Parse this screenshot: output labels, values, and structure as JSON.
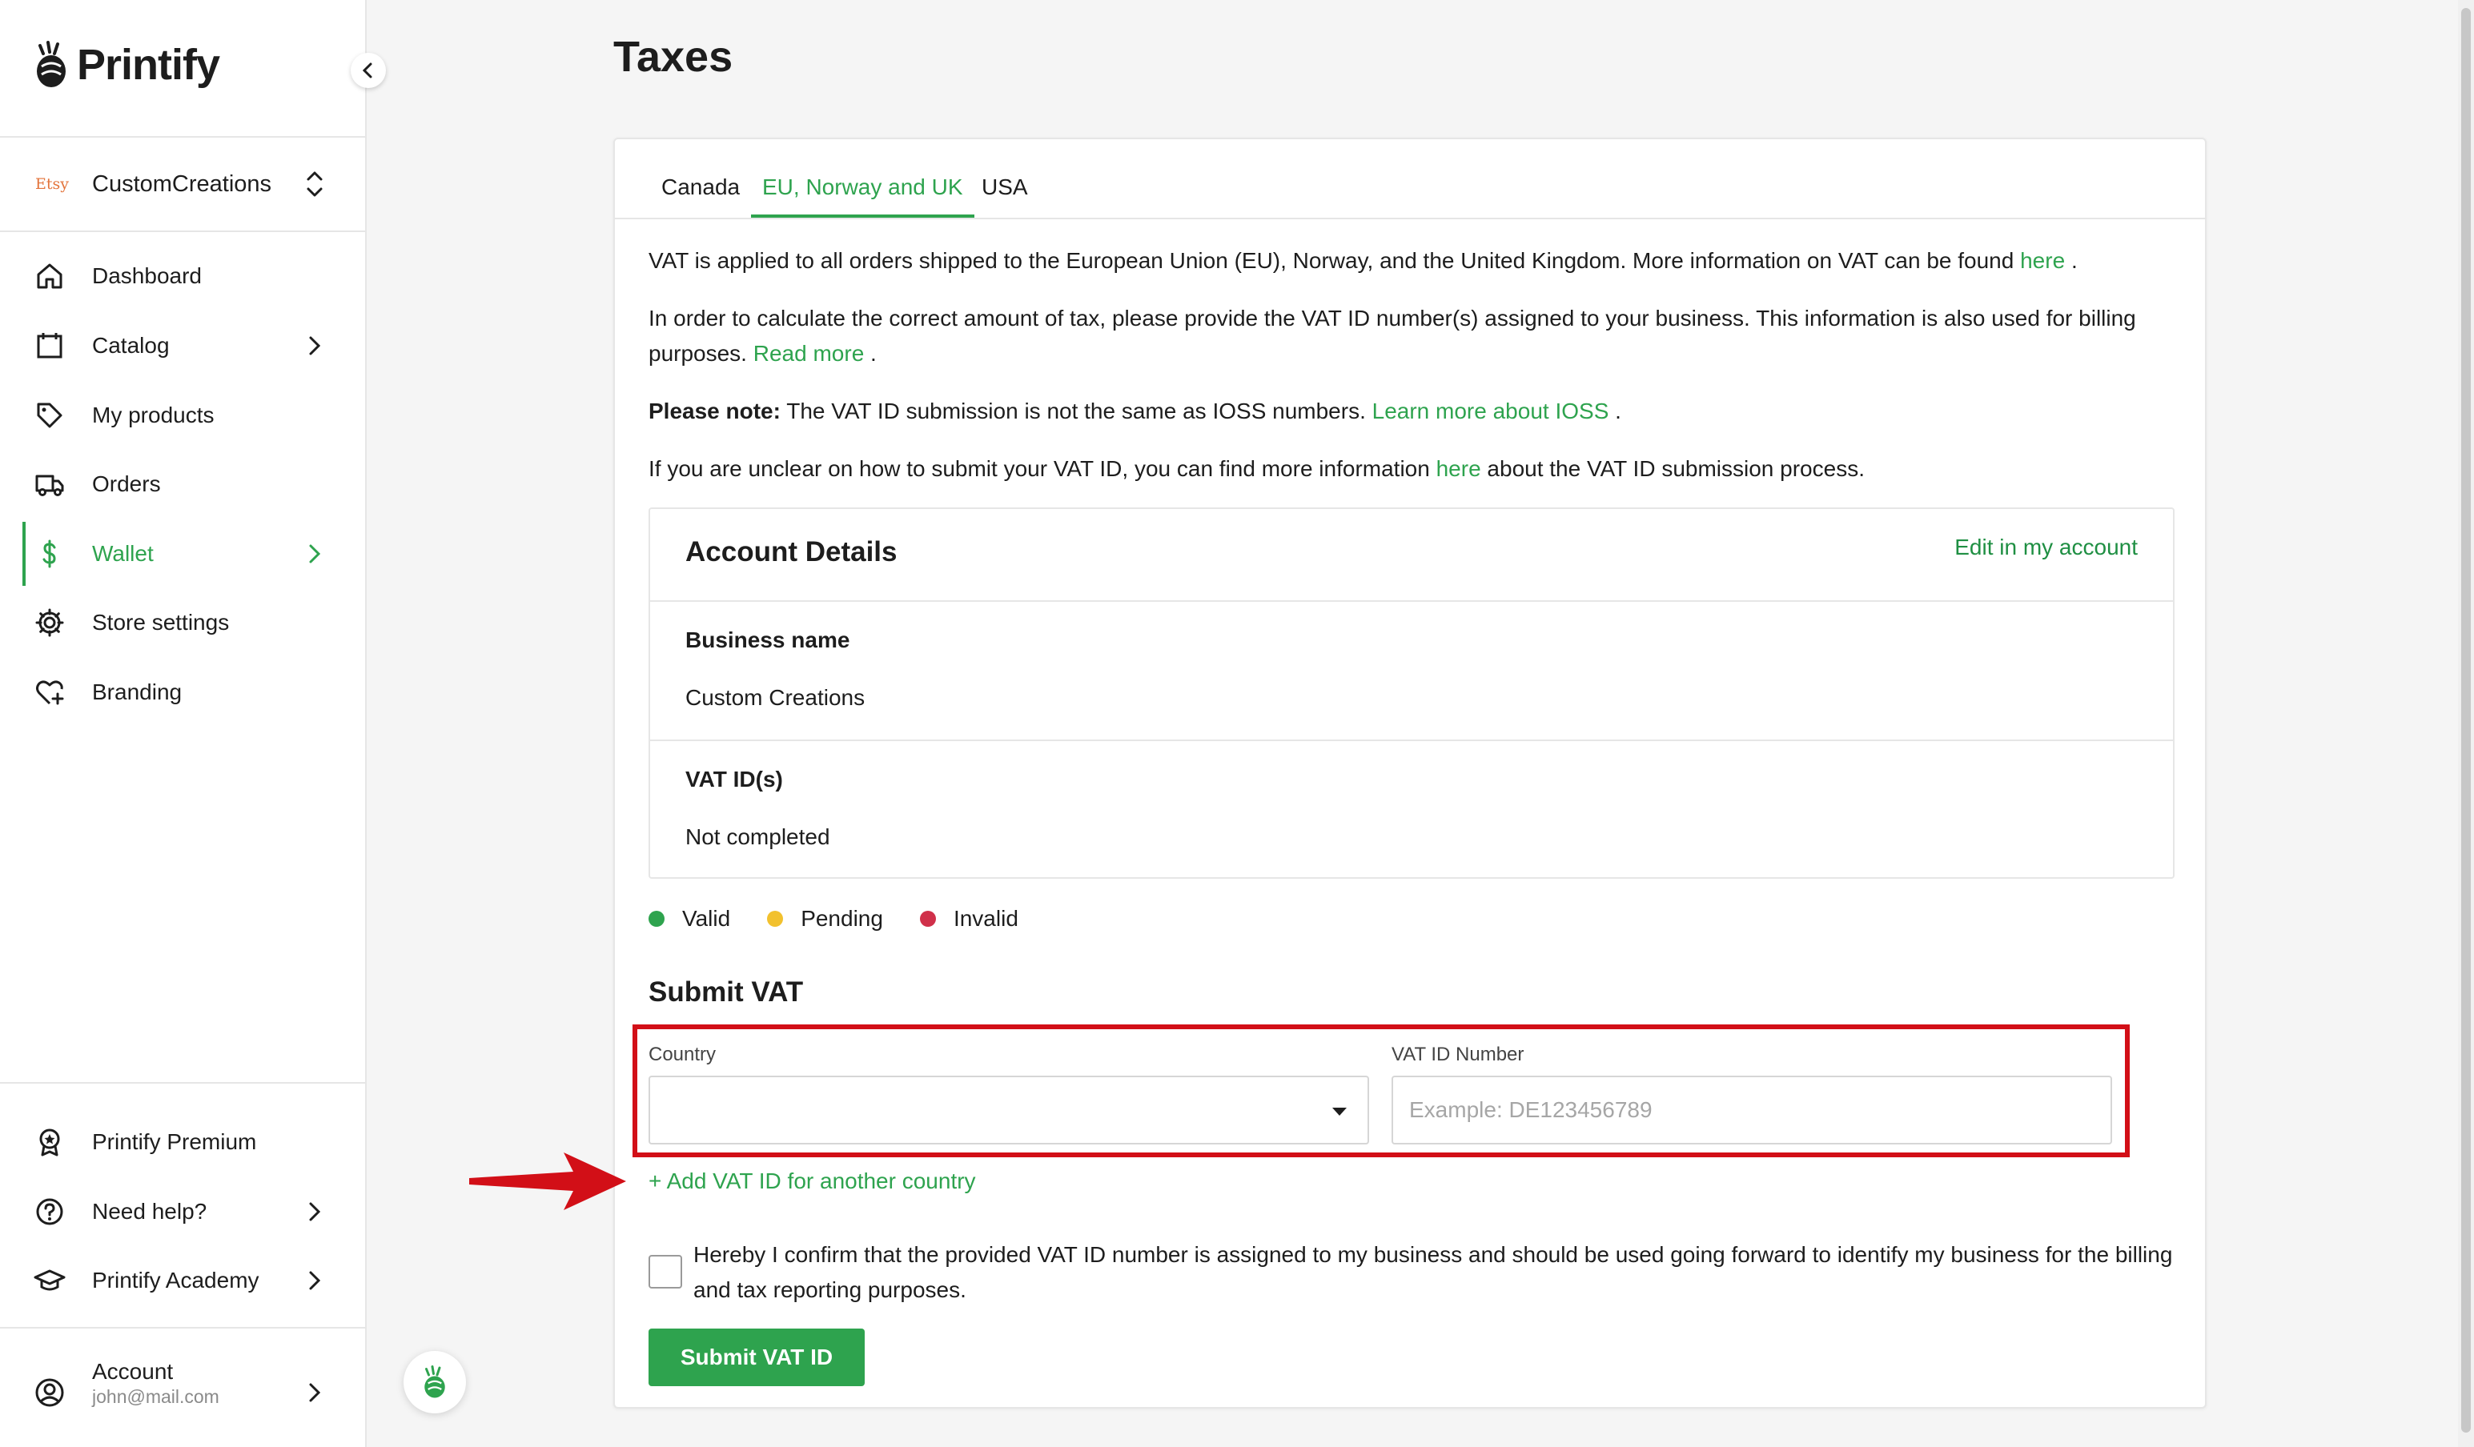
{
  "brand": {
    "name": "Printify"
  },
  "store": {
    "marketplace": "Etsy",
    "name": "CustomCreations"
  },
  "nav": {
    "dashboard": "Dashboard",
    "catalog": "Catalog",
    "my_products": "My products",
    "orders": "Orders",
    "wallet": "Wallet",
    "store_settings": "Store settings",
    "branding": "Branding",
    "premium": "Printify Premium",
    "help": "Need help?",
    "academy": "Printify Academy",
    "account": "Account",
    "account_email": "john@mail.com"
  },
  "page": {
    "title": "Taxes"
  },
  "tabs": [
    {
      "label": "Canada",
      "active": false
    },
    {
      "label": "EU, Norway and UK",
      "active": true
    },
    {
      "label": "USA",
      "active": false
    }
  ],
  "info": {
    "p1_text": "VAT is applied to all orders shipped to the European Union (EU), Norway, and the United Kingdom. More information on VAT can be found",
    "p1_link": "here",
    "p1_end": ".",
    "p2_text": "In order to calculate the correct amount of tax, please provide the VAT ID number(s) assigned to your business. This information is also used for billing purposes.",
    "p2_link": "Read more",
    "p2_end": ".",
    "p3_bold": "Please note:",
    "p3_text": "The VAT ID submission is not the same as IOSS numbers.",
    "p3_link": "Learn more about IOSS",
    "p3_end": ".",
    "p4_text": "If you are unclear on how to submit your VAT ID, you can find more information",
    "p4_link": "here",
    "p4_end": "about the VAT ID submission process."
  },
  "account_details": {
    "title": "Account Details",
    "edit_link": "Edit in my account",
    "business_name_label": "Business name",
    "business_name_value": "Custom Creations",
    "vat_ids_label": "VAT ID(s)",
    "vat_ids_value": "Not completed"
  },
  "legend": [
    {
      "label": "Valid",
      "color": "#2ea34e"
    },
    {
      "label": "Pending",
      "color": "#f2c12e"
    },
    {
      "label": "Invalid",
      "color": "#d0304a"
    }
  ],
  "submit_vat": {
    "title": "Submit VAT",
    "country_label": "Country",
    "country_value": "",
    "vat_number_label": "VAT ID Number",
    "vat_number_placeholder": "Example: DE123456789",
    "add_country_link": "+ Add VAT ID for another country",
    "confirm_text": "Hereby I confirm that the provided VAT ID number is assigned to my business and should be used going forward to identify my business for the billing and tax reporting purposes.",
    "confirm_checked": false,
    "submit_button": "Submit VAT ID"
  },
  "colors": {
    "accent": "#2ea34e",
    "highlight": "#d20f17"
  }
}
